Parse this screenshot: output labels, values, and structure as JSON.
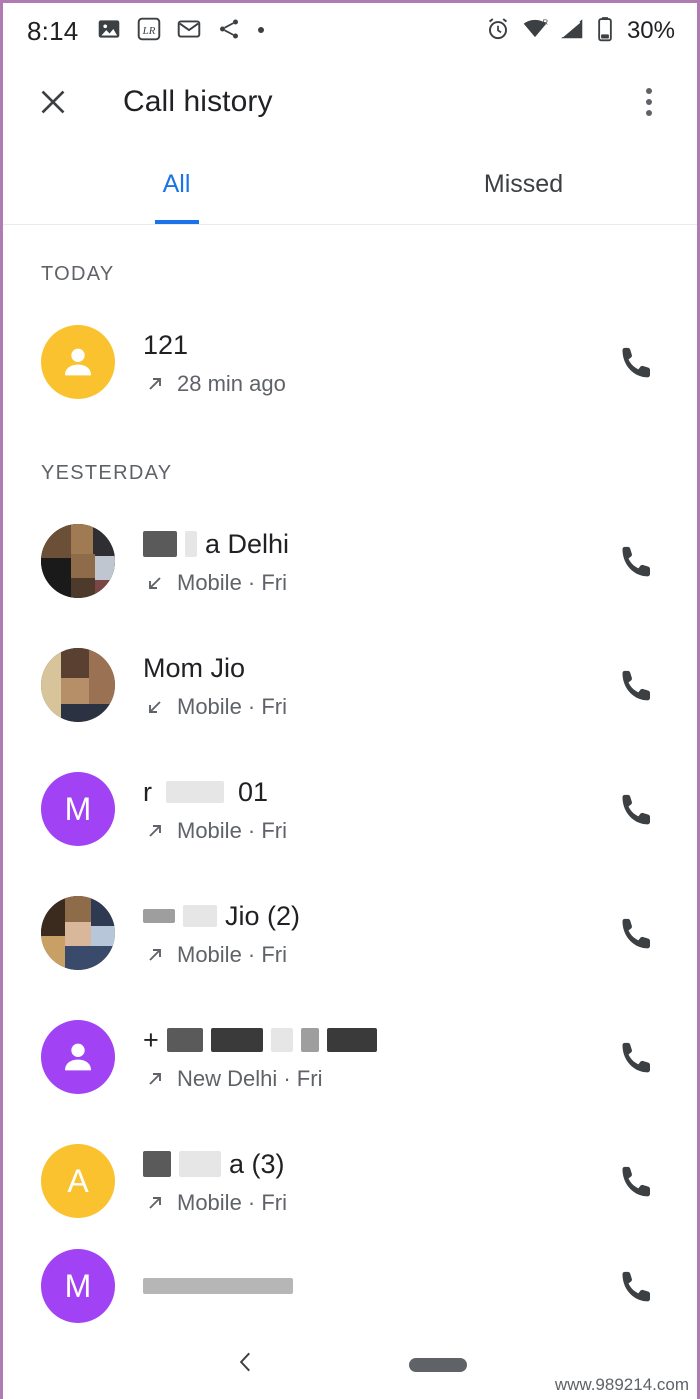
{
  "status_bar": {
    "time": "8:14",
    "left_icons": [
      "image-icon",
      "lr-app-icon",
      "mail-icon",
      "share-icon",
      "dot-icon"
    ],
    "right_icons": [
      "alarm-icon",
      "wifi-icon",
      "signal-icon",
      "battery-icon"
    ],
    "battery_text": "30%"
  },
  "app_bar": {
    "close_icon": "close-icon",
    "title": "Call history",
    "overflow_icon": "more-vert-icon"
  },
  "tabs": [
    {
      "label": "All",
      "active": true
    },
    {
      "label": "Missed",
      "active": false
    }
  ],
  "sections": [
    {
      "header": "TODAY",
      "rows": [
        {
          "avatar": {
            "type": "person-icon",
            "color": "#f9c22e",
            "letter": ""
          },
          "title": "121",
          "direction": "outgoing",
          "subtitle": "28 min ago",
          "redacted": false,
          "call_icon": "phone-icon"
        }
      ]
    },
    {
      "header": "YESTERDAY",
      "rows": [
        {
          "avatar": {
            "type": "photo",
            "color": "#8a7560",
            "letter": ""
          },
          "title": "a Delhi",
          "title_redacted_prefix": true,
          "direction": "incoming",
          "subtitle": "Mobile · Fri",
          "call_icon": "phone-icon"
        },
        {
          "avatar": {
            "type": "photo",
            "color": "#6e5a47",
            "letter": ""
          },
          "title": "Mom Jio",
          "title_redacted_prefix": false,
          "direction": "incoming",
          "subtitle": "Mobile · Fri",
          "call_icon": "phone-icon"
        },
        {
          "avatar": {
            "type": "letter",
            "color": "#a142f4",
            "letter": "M"
          },
          "title": "r        01",
          "title_redacted_prefix": false,
          "direction": "outgoing",
          "subtitle": "Mobile · Fri",
          "call_icon": "phone-icon"
        },
        {
          "avatar": {
            "type": "photo",
            "color": "#7a5f3f",
            "letter": ""
          },
          "title": "Jio  (2)",
          "title_redacted_prefix": true,
          "direction": "outgoing",
          "subtitle": "Mobile · Fri",
          "call_icon": "phone-icon"
        },
        {
          "avatar": {
            "type": "person-icon",
            "color": "#a142f4",
            "letter": ""
          },
          "title": "+",
          "title_redacted_prefix": true,
          "direction": "outgoing",
          "subtitle": "New Delhi · Fri",
          "call_icon": "phone-icon"
        },
        {
          "avatar": {
            "type": "letter",
            "color": "#f9c22e",
            "letter": "A"
          },
          "title": "a  (3)",
          "title_redacted_prefix": true,
          "direction": "outgoing",
          "subtitle": "Mobile · Fri",
          "call_icon": "phone-icon"
        },
        {
          "avatar": {
            "type": "letter",
            "color": "#a142f4",
            "letter": "M"
          },
          "title": "",
          "title_redacted_prefix": true,
          "direction": "outgoing",
          "subtitle": "",
          "call_icon": "phone-icon"
        }
      ]
    }
  ],
  "nav_bar": {
    "back_icon": "chevron-left-icon",
    "home_pill": "home-pill-icon"
  },
  "watermark": "www.989214.com",
  "colors": {
    "accent": "#1a73e8",
    "primary_text": "#202124",
    "secondary_text": "#5f6368",
    "avatar_yellow": "#f9c22e",
    "avatar_purple": "#a142f4"
  }
}
